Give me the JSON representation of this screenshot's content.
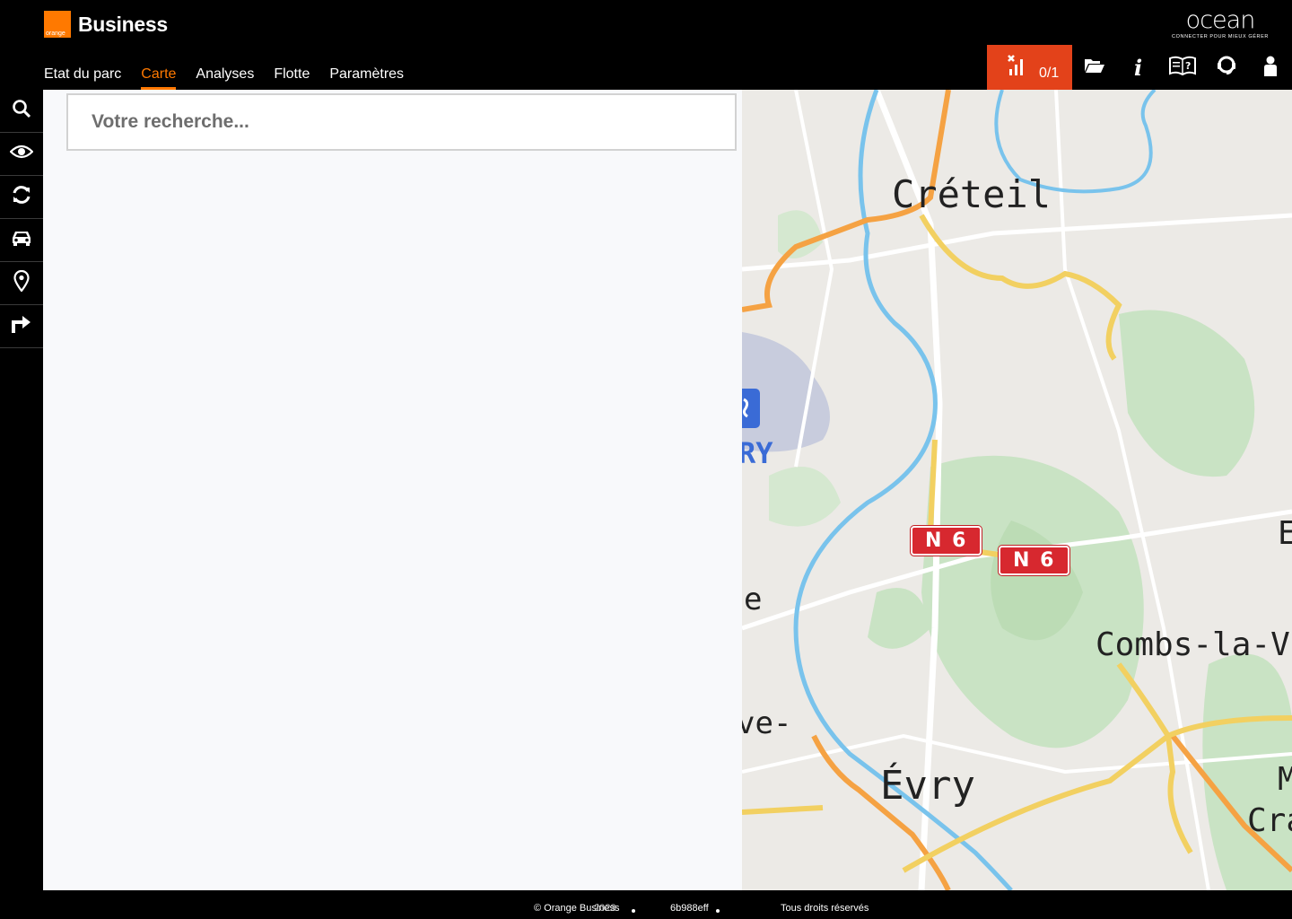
{
  "brand": {
    "logo_text": "orange",
    "name": "Business"
  },
  "ocean_logo": {
    "word": "ocean",
    "tagline": "CONNECTER POUR MIEUX GÉRER"
  },
  "nav": {
    "items": [
      {
        "label": "Etat du parc",
        "active": false
      },
      {
        "label": "Carte",
        "active": true
      },
      {
        "label": "Analyses",
        "active": false
      },
      {
        "label": "Flotte",
        "active": false
      },
      {
        "label": "Paramètres",
        "active": false
      }
    ]
  },
  "toolbar": {
    "alert_count": "0/1",
    "info_label": "i",
    "icons": [
      "signal-off-icon",
      "folder-open-icon",
      "info-icon",
      "help-book-icon",
      "support-headset-icon",
      "user-icon"
    ],
    "accent": "#e3421a"
  },
  "sidebar": {
    "icons": [
      "search-icon",
      "eye-icon",
      "refresh-icon",
      "car-icon",
      "location-pin-icon",
      "route-arrow-icon"
    ],
    "active": "search-icon"
  },
  "search": {
    "placeholder": "Votre recherche..."
  },
  "map": {
    "labels": [
      {
        "text": "Créteil"
      },
      {
        "text": "Évry"
      },
      {
        "text": "Combs-la-Vi"
      },
      {
        "text": "E"
      },
      {
        "text": "M"
      },
      {
        "text": "Cra"
      },
      {
        "text": "RY"
      },
      {
        "text": "e"
      },
      {
        "text": "ve-"
      }
    ],
    "shields": [
      "N 6",
      "N 6"
    ]
  },
  "footer": {
    "copyright": "© Orange Business",
    "year": "2023",
    "build": "6b988eff",
    "rights": "Tous droits réservés"
  },
  "colors": {
    "orange": "#ff7900",
    "alert_red": "#e3421a",
    "road_red": "#d7282f"
  }
}
